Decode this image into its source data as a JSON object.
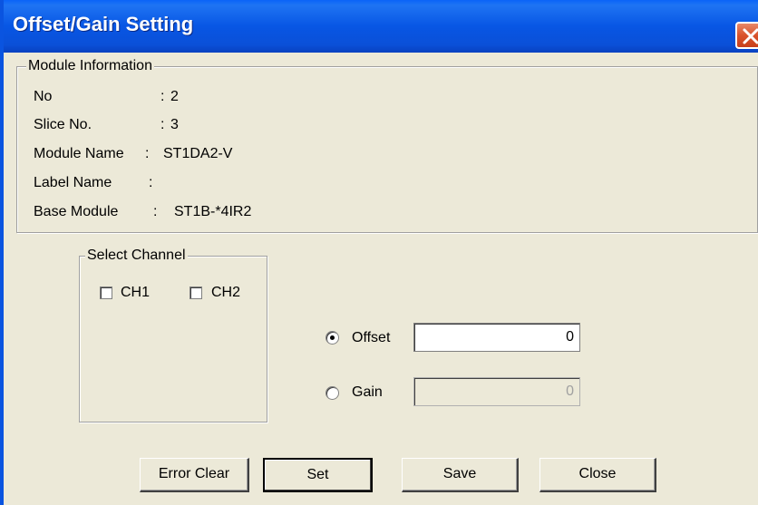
{
  "window": {
    "title": "Offset/Gain Setting"
  },
  "module_info": {
    "legend": "Module Information",
    "rows": [
      {
        "label": "No",
        "sep": ":",
        "value": "2"
      },
      {
        "label": "Slice No.",
        "sep": ":",
        "value": "3"
      },
      {
        "label": "Module Name",
        "sep": ":",
        "value": "ST1DA2-V"
      },
      {
        "label": "Label Name",
        "sep": ":",
        "value": ""
      },
      {
        "label": "Base Module",
        "sep": ":",
        "value": "ST1B-*4IR2"
      }
    ]
  },
  "select_channel": {
    "legend": "Select Channel",
    "channels": [
      {
        "label": "CH1",
        "checked": false
      },
      {
        "label": "CH2",
        "checked": false
      }
    ]
  },
  "mode": {
    "offset": {
      "label": "Offset",
      "selected": true,
      "value": "0",
      "enabled": true
    },
    "gain": {
      "label": "Gain",
      "selected": false,
      "value": "0",
      "enabled": false
    }
  },
  "buttons": {
    "error_clear": "Error Clear",
    "set": "Set",
    "save": "Save",
    "close": "Close"
  },
  "colors": {
    "titlebar": "#0a54e0",
    "close_button": "#d9532c",
    "dialog_background": "#ece9d8"
  }
}
